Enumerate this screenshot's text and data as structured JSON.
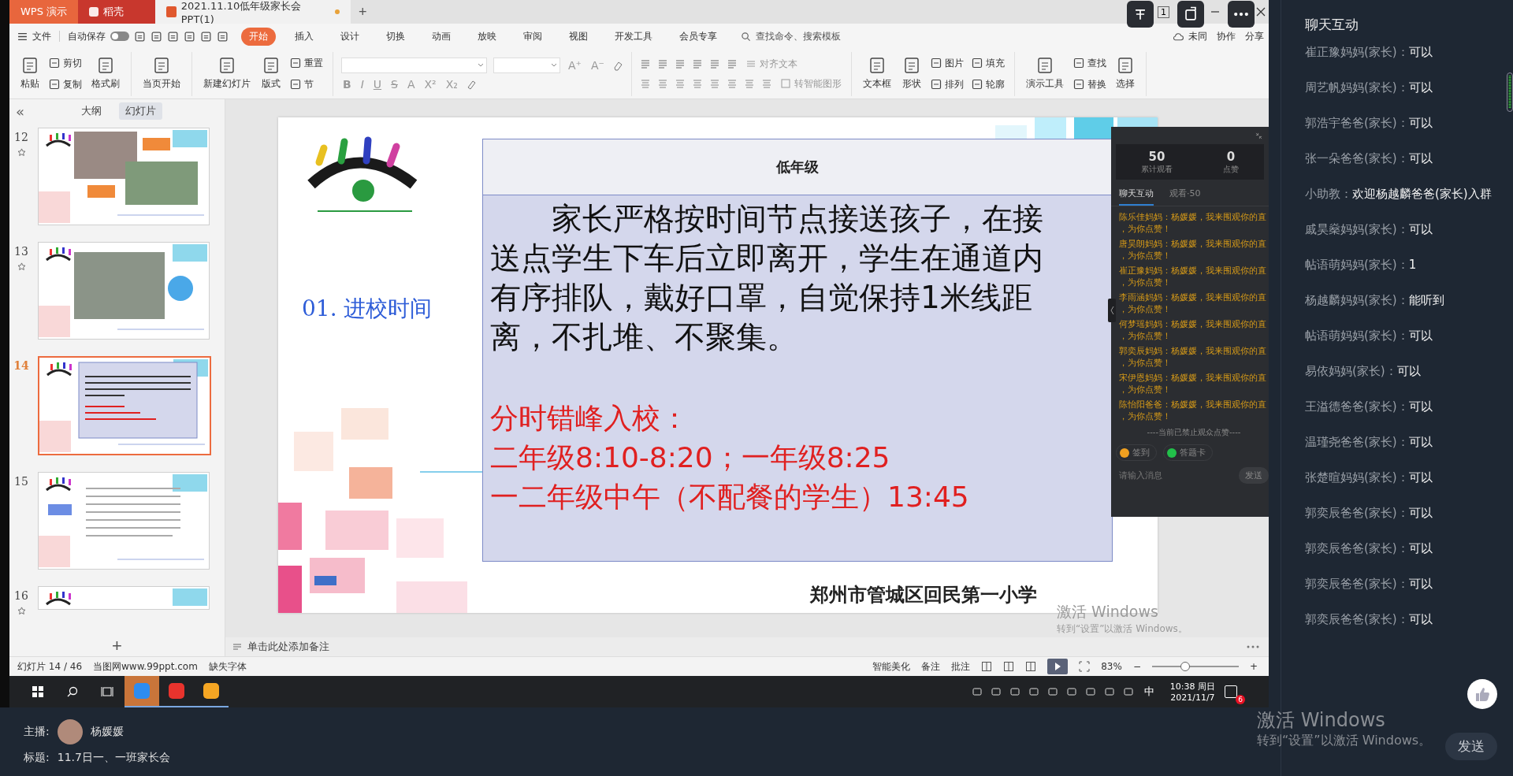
{
  "app_tabs": [
    {
      "label": "WPS 演示",
      "kind": "wps"
    },
    {
      "label": "稻壳",
      "kind": "docer"
    },
    {
      "label": "2021.11.10低年级家长会PPT(1)",
      "kind": "doc"
    }
  ],
  "new_tab": "+",
  "window_badge": "1",
  "file_menu": "文件",
  "autosave": {
    "label": "自动保存",
    "on": false
  },
  "ribbon_tabs": [
    {
      "label": "开始",
      "selected": true
    },
    {
      "label": "插入",
      "selected": false
    },
    {
      "label": "设计",
      "selected": false
    },
    {
      "label": "切换",
      "selected": false
    },
    {
      "label": "动画",
      "selected": false
    },
    {
      "label": "放映",
      "selected": false
    },
    {
      "label": "审阅",
      "selected": false
    },
    {
      "label": "视图",
      "selected": false
    },
    {
      "label": "开发工具",
      "selected": false
    },
    {
      "label": "会员专享",
      "selected": false
    }
  ],
  "command_search": {
    "placeholder": "查找命令、搜索模板"
  },
  "menu_right": [
    "未同",
    "协作",
    "分享"
  ],
  "ribbon_groups": [
    {
      "kind": "buttons",
      "columns": [
        [
          {
            "label": "粘贴"
          }
        ],
        [
          {
            "label": "剪切"
          },
          {
            "label": "复制"
          }
        ],
        [
          {
            "label": "格式刷"
          }
        ]
      ]
    },
    {
      "kind": "buttons",
      "columns": [
        [
          {
            "label": "当页开始"
          }
        ]
      ]
    },
    {
      "kind": "buttons",
      "columns": [
        [
          {
            "label": "新建幻灯片"
          }
        ],
        [
          {
            "label": "版式"
          }
        ],
        [
          {
            "label": "重置"
          },
          {
            "label": "节"
          }
        ]
      ]
    },
    {
      "kind": "font",
      "size_glyphs": [
        "A⁺",
        "A⁻"
      ],
      "glyphs": [
        "B",
        "I",
        "U",
        "S",
        "A",
        "X²",
        "X₂"
      ]
    },
    {
      "kind": "paragraph",
      "labels": [
        "对齐文本",
        "转智能图形"
      ]
    },
    {
      "kind": "buttons",
      "columns": [
        [
          {
            "label": "文本框"
          }
        ],
        [
          {
            "label": "形状"
          }
        ],
        [
          {
            "label": "图片"
          },
          {
            "label": "排列"
          }
        ],
        [
          {
            "label": "填充"
          },
          {
            "label": "轮廓"
          }
        ]
      ]
    },
    {
      "kind": "buttons",
      "columns": [
        [
          {
            "label": "演示工具"
          }
        ],
        [
          {
            "label": "查找"
          },
          {
            "label": "替换"
          }
        ],
        [
          {
            "label": "选择"
          }
        ]
      ]
    }
  ],
  "slide_panel": {
    "collapse": "«",
    "tabs": [
      {
        "label": "大纲",
        "selected": false
      },
      {
        "label": "幻灯片",
        "selected": true
      }
    ],
    "slides": [
      {
        "number": "12",
        "kind": "photos",
        "animated": true,
        "selected": false
      },
      {
        "number": "13",
        "kind": "photo",
        "animated": true,
        "selected": false
      },
      {
        "number": "14",
        "kind": "textbox",
        "animated": false,
        "selected": true
      },
      {
        "number": "15",
        "kind": "list",
        "animated": false,
        "selected": false
      },
      {
        "number": "16",
        "kind": "partial",
        "animated": true,
        "selected": false
      }
    ],
    "add": "+"
  },
  "slide": {
    "title": "01. 进校时间",
    "box_header": "低年级",
    "paragraph": "家长严格按时间节点接送孩子，在接送点学生下车后立即离开，学生在通道内有序排队，戴好口罩，自觉保持1米线距离，不扎堆、不聚集。",
    "red_lines": [
      "分时错峰入校：",
      "二年级8:10-8:20；一年级8:25",
      "一二年级中午（不配餐的学生）13:45"
    ],
    "footer": "郑州市管城区回民第一小学"
  },
  "live_overlay": {
    "stats": [
      {
        "value": "50",
        "label": "累计观看"
      },
      {
        "value": "0",
        "label": "点赞"
      }
    ],
    "tabs": [
      {
        "label": "聊天互动",
        "selected": true
      },
      {
        "label": "观看·50",
        "selected": false
      }
    ],
    "messages": [
      {
        "name": "陈乐佳妈妈：",
        "text": "杨媛媛，我来围观你的直",
        "tail": "，为你点赞！"
      },
      {
        "name": "唐昊朗妈妈：",
        "text": "杨媛媛，我来围观你的直",
        "tail": "，为你点赞！"
      },
      {
        "name": "崔正豫妈妈：",
        "text": "杨媛媛，我来围观你的直",
        "tail": "，为你点赞！"
      },
      {
        "name": "李雨涵妈妈：",
        "text": "杨媛媛，我来围观你的直",
        "tail": "，为你点赞！"
      },
      {
        "name": "何梦瑶妈妈：",
        "text": "杨媛媛，我来围观你的直",
        "tail": "，为你点赞！"
      },
      {
        "name": "郭奕辰妈妈：",
        "text": "杨媛媛，我来围观你的直",
        "tail": "，为你点赞！"
      },
      {
        "name": "宋伊恩妈妈：",
        "text": "杨媛媛，我来围观你的直",
        "tail": "，为你点赞！"
      },
      {
        "name": "陈怡阳爸爸：",
        "text": "杨媛媛，我来围观你的直",
        "tail": "，为你点赞！"
      }
    ],
    "notice": "----当前已禁止观众点赞----",
    "actions": [
      {
        "label": "签到",
        "color": "#f0a020"
      },
      {
        "label": "答题卡",
        "color": "#22c04a"
      }
    ],
    "input": {
      "placeholder": "请输入消息"
    },
    "send": "发送"
  },
  "notes": {
    "placeholder": "单击此处添加备注"
  },
  "status_bar": {
    "slide_count": "幻灯片 14 / 46",
    "template": "当图网www.99ppt.com",
    "missing_fonts": "缺失字体",
    "beautify": "智能美化",
    "notes": "备注",
    "comments": "批注",
    "zoom": "83%",
    "zoom_minus": "−",
    "zoom_plus": "+",
    "zoom_slider": {
      "level": 0.37
    }
  },
  "taskbar": {
    "apps": [
      {
        "kind": "browser",
        "selected": true
      },
      {
        "kind": "wps",
        "selected": false
      },
      {
        "kind": "live",
        "selected": false
      }
    ],
    "ime": "中",
    "time": "10:38 周日",
    "date": "2021/11/7",
    "notification_count": "6"
  },
  "inner_watermark": {
    "title": "激活 Windows",
    "hint": "转到“设置”以激活 Windows。"
  },
  "host": {
    "label": "主播:",
    "name": "杨媛媛"
  },
  "stream_title": {
    "label": "标题:",
    "value": "11.7日一、一班家长会"
  },
  "chat": {
    "title": "聊天互动",
    "messages": [
      {
        "name": "崔正豫妈妈(家长)：",
        "text": "可以"
      },
      {
        "name": "周艺帆妈妈(家长)：",
        "text": "可以"
      },
      {
        "name": "郭浩宇爸爸(家长)：",
        "text": "可以"
      },
      {
        "name": "张一朵爸爸(家长)：",
        "text": "可以"
      },
      {
        "name": "小助教：",
        "text": "欢迎杨越麟爸爸(家长)入群"
      },
      {
        "name": "戚昊燊妈妈(家长)：",
        "text": "可以"
      },
      {
        "name": "帖语萌妈妈(家长)：",
        "text": "1"
      },
      {
        "name": "杨越麟妈妈(家长)：",
        "text": "能听到"
      },
      {
        "name": "帖语萌妈妈(家长)：",
        "text": "可以"
      },
      {
        "name": "易依妈妈(家长)：",
        "text": "可以"
      },
      {
        "name": "王溢德爸爸(家长)：",
        "text": "可以"
      },
      {
        "name": "温瑾尧爸爸(家长)：",
        "text": "可以"
      },
      {
        "name": "张楚暄妈妈(家长)：",
        "text": "可以"
      },
      {
        "name": "郭奕辰爸爸(家长)：",
        "text": "可以"
      },
      {
        "name": "郭奕辰爸爸(家长)：",
        "text": "可以"
      },
      {
        "name": "郭奕辰爸爸(家长)：",
        "text": "可以"
      },
      {
        "name": "郭奕辰爸爸(家长)：",
        "text": "可以"
      }
    ],
    "send": "发送"
  },
  "outer_watermark": {
    "title": "激活 Windows",
    "hint": "转到“设置”以激活 Windows。"
  }
}
